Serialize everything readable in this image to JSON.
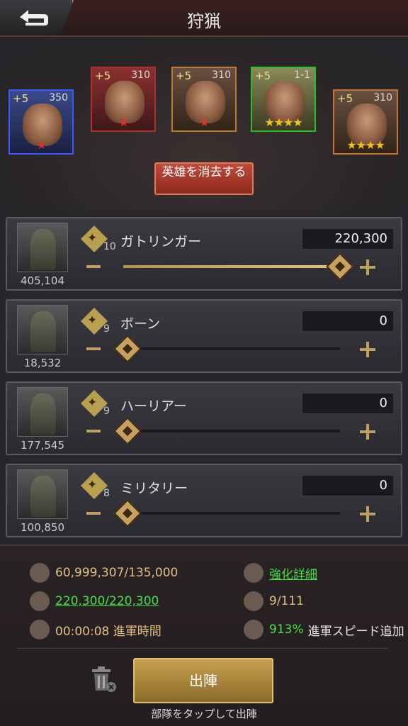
{
  "header": {
    "title": "狩猟"
  },
  "heroes": [
    {
      "level": "+5",
      "num": "350",
      "stars": "★",
      "star_color": "red"
    },
    {
      "level": "+5",
      "num": "310",
      "stars": "★",
      "star_color": "red"
    },
    {
      "level": "+5",
      "num": "310",
      "stars": "★",
      "star_color": "red"
    },
    {
      "level": "+5",
      "num": "1-1",
      "stars": "★★★★",
      "star_color": "gold"
    },
    {
      "level": "+5",
      "num": "310",
      "stars": "★★★★",
      "star_color": "gold"
    }
  ],
  "dismiss_button": {
    "label": "英雄を消去する"
  },
  "troops": [
    {
      "name": "ガトリンガー",
      "level": "10",
      "count": "405,104",
      "qty": "220,300",
      "slider": 1.0,
      "icon": "gun-icon"
    },
    {
      "name": "ボーン",
      "level": "9",
      "count": "18,532",
      "qty": "0",
      "slider": 0.0,
      "icon": "axe-icon"
    },
    {
      "name": "ハーリアー",
      "level": "9",
      "count": "177,545",
      "qty": "0",
      "slider": 0.0,
      "icon": "motorbike-icon"
    },
    {
      "name": "ミリタリー",
      "level": "8",
      "count": "100,850",
      "qty": "0",
      "slider": 0.0,
      "icon": "axe-icon"
    }
  ],
  "stats": {
    "load": "60,999,307/135,000",
    "upgrade_details": "強化詳細",
    "troops": "220,300/220,300",
    "potions": "9/111",
    "march_time": "00:00:08 進軍時間",
    "speed_bonus": "913%",
    "speed_bonus_label": "進軍スピード追加"
  },
  "deploy_button": {
    "label": "出陣"
  },
  "deploy_hint": "部隊をタップして出陣",
  "colors": {
    "accent": "#c8a060",
    "green": "#44e044"
  }
}
